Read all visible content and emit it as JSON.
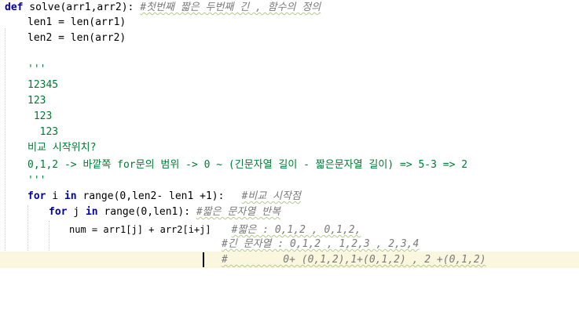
{
  "colors": {
    "keyword": "#0000aa",
    "comment": "#7a7a7a",
    "string": "#007a33",
    "current_line": "#fbf7df"
  },
  "code": {
    "l1_kw": "def",
    "l1_sig": " solve(arr1,arr2): ",
    "l1_cmt": "#첫번째 짧은 두번째 긴 , 함수의 정의",
    "l2": "len1 = len(arr1)",
    "l3": "len2 = len(arr2)",
    "l4": "'''",
    "l5": "12345",
    "l6": "123",
    "l7": " 123",
    "l8": "  123",
    "l9": "비교 시작위치?",
    "l10": "0,1,2 -> 바깥쪽 for문의 범위 -> 0 ~ (긴문자열 길이 - 짧은문자열 길이) => 5-3 => 2",
    "l11": "'''",
    "l12_kw1": "for",
    "l12_mid1": " i ",
    "l12_kw2": "in",
    "l12_rest": " range(0,len2- len1 +1):",
    "l12_cmt": "#비교 시작점",
    "l13_kw1": "for",
    "l13_mid1": " j ",
    "l13_kw2": "in",
    "l13_rest": " range(0,len1): ",
    "l13_cmt": "#짧은 문자열 반복",
    "l14_code": "num = arr1[j] + arr2[i+j]",
    "l14_cmt": "#짧은 : 0,1,2 , 0,1,2,",
    "l15_cmt": "#긴 문자열 : 0,1,2 , 1,2,3 , 2,3,4",
    "l16_cmt": "#         0+ (0,1,2),1+(0,1,2) , 2 +(0,1,2)"
  }
}
